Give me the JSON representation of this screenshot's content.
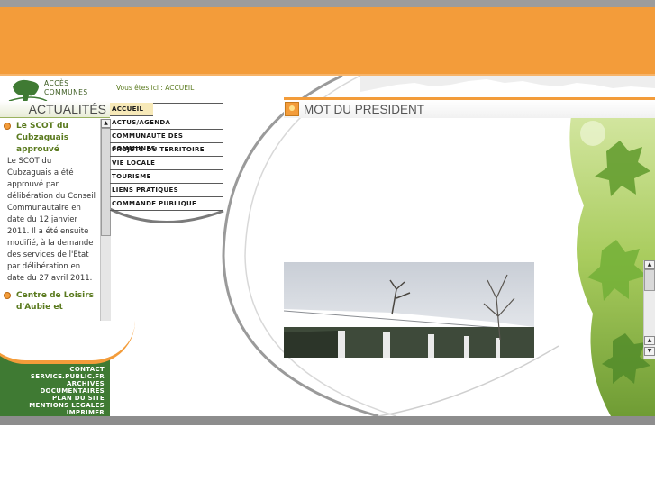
{
  "logo": {
    "line1": "ACCÈS",
    "line2": "COMMUNES"
  },
  "left": {
    "actualites_title": "ACTUALITÉS",
    "news": [
      {
        "title": "Le SCOT du Cubzaguais approuvé",
        "body": "Le SCOT du Cubzaguais a été approuvé par délibération du Conseil Communautaire en date du 12 janvier 2011. Il a été ensuite modifié, à la demande des services de l'Etat par délibération en date du 27 avril 2011."
      },
      {
        "title": "Centre de Loisirs d'Aubie et",
        "body": ""
      }
    ],
    "footer_links": [
      "CONTACT",
      "SERVICE.PUBLIC.FR",
      "ARCHIVES DOCUMENTAIRES",
      "PLAN DU SITE",
      "MENTIONS LEGALES",
      "IMPRIMER"
    ]
  },
  "breadcrumb": "Vous êtes ici : ACCUEIL",
  "nav": [
    "ACCUEIL",
    "ACTUS/AGENDA",
    "COMMUNAUTE DES COMMUNES",
    "PROJETS DU TERRITOIRE",
    "VIE LOCALE",
    "TOURISME",
    "LIENS PRATIQUES",
    "COMMANDE PUBLIQUE"
  ],
  "main": {
    "title": "MOT DU PRESIDENT"
  },
  "colors": {
    "orange": "#f39c3a",
    "green": "#3f7a33",
    "frame_gray": "#9c9c9c"
  },
  "icons": [
    "logo-tree-icon",
    "news-bullet-icon",
    "scroll-up-icon",
    "scroll-down-icon",
    "title-icon"
  ]
}
